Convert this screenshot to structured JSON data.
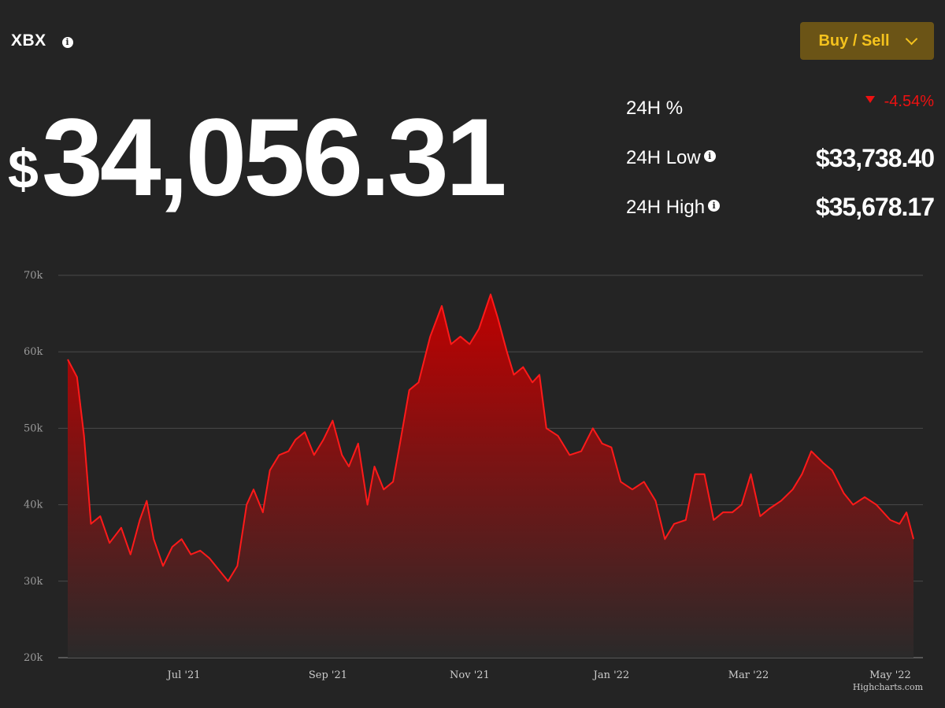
{
  "header": {
    "ticker": "XBX",
    "buy_sell_label": "Buy / Sell"
  },
  "price": {
    "currency": "$",
    "value": "34,056.31"
  },
  "stats": {
    "change_label": "24H %",
    "change_value": "-4.54%",
    "low_label": "24H Low",
    "low_value": "$33,738.40",
    "high_label": "24H High",
    "high_value": "$35,678.17"
  },
  "colors": {
    "background": "#242424",
    "line": "#ff1a1a",
    "accent": "#f4c21d",
    "button_bg": "#6b5416",
    "negative": "#ee1111"
  },
  "chart_data": {
    "type": "area",
    "title": "",
    "xlabel": "",
    "ylabel": "",
    "ylim": [
      20000,
      70000
    ],
    "yticks": [
      20000,
      30000,
      40000,
      50000,
      60000,
      70000
    ],
    "ytick_labels": [
      "20k",
      "30k",
      "40k",
      "50k",
      "60k",
      "70k"
    ],
    "xticks": [
      "2021-07-01",
      "2021-09-01",
      "2021-11-01",
      "2022-01-01",
      "2022-03-01",
      "2022-05-01"
    ],
    "xtick_labels": [
      "Jul '21",
      "Sep '21",
      "Nov '21",
      "Jan '22",
      "Mar '22",
      "May '22"
    ],
    "xlim": [
      "2021-05-12",
      "2022-05-11"
    ],
    "grid": true,
    "series": [
      {
        "x": [
          "2021-05-12",
          "2021-05-16",
          "2021-05-19",
          "2021-05-22",
          "2021-05-26",
          "2021-05-30",
          "2021-06-04",
          "2021-06-08",
          "2021-06-12",
          "2021-06-15",
          "2021-06-18",
          "2021-06-22",
          "2021-06-26",
          "2021-06-30",
          "2021-07-04",
          "2021-07-08",
          "2021-07-12",
          "2021-07-16",
          "2021-07-20",
          "2021-07-24",
          "2021-07-28",
          "2021-07-31",
          "2021-08-04",
          "2021-08-07",
          "2021-08-11",
          "2021-08-15",
          "2021-08-18",
          "2021-08-22",
          "2021-08-26",
          "2021-08-30",
          "2021-09-03",
          "2021-09-07",
          "2021-09-10",
          "2021-09-14",
          "2021-09-18",
          "2021-09-21",
          "2021-09-25",
          "2021-09-29",
          "2021-10-02",
          "2021-10-06",
          "2021-10-10",
          "2021-10-15",
          "2021-10-20",
          "2021-10-24",
          "2021-10-28",
          "2021-11-01",
          "2021-11-05",
          "2021-11-10",
          "2021-11-13",
          "2021-11-17",
          "2021-11-20",
          "2021-11-24",
          "2021-11-28",
          "2021-12-01",
          "2021-12-04",
          "2021-12-09",
          "2021-12-14",
          "2021-12-19",
          "2021-12-24",
          "2021-12-28",
          "2022-01-01",
          "2022-01-05",
          "2022-01-10",
          "2022-01-15",
          "2022-01-20",
          "2022-01-24",
          "2022-01-28",
          "2022-02-02",
          "2022-02-06",
          "2022-02-10",
          "2022-02-14",
          "2022-02-18",
          "2022-02-22",
          "2022-02-26",
          "2022-03-02",
          "2022-03-06",
          "2022-03-10",
          "2022-03-15",
          "2022-03-20",
          "2022-03-24",
          "2022-03-28",
          "2022-04-02",
          "2022-04-06",
          "2022-04-11",
          "2022-04-15",
          "2022-04-20",
          "2022-04-25",
          "2022-05-01",
          "2022-05-05",
          "2022-05-08",
          "2022-05-11"
        ],
        "values": [
          59000,
          56700,
          49000,
          37500,
          38500,
          35000,
          37000,
          33500,
          38000,
          40500,
          35500,
          32000,
          34500,
          35500,
          33500,
          34000,
          33000,
          31500,
          30000,
          32000,
          40000,
          42000,
          39000,
          44500,
          46500,
          47000,
          48500,
          49500,
          46500,
          48500,
          51000,
          46500,
          45000,
          48000,
          40000,
          45000,
          42000,
          43000,
          48000,
          55000,
          56000,
          62000,
          66000,
          61000,
          62000,
          61000,
          63000,
          67500,
          64500,
          60000,
          57000,
          58000,
          56000,
          57000,
          50000,
          49000,
          46500,
          47000,
          50000,
          48000,
          47500,
          43000,
          42000,
          43000,
          40500,
          35500,
          37500,
          38000,
          44000,
          44000,
          38000,
          39000,
          39000,
          40000,
          44000,
          38500,
          39500,
          40500,
          42000,
          44000,
          47000,
          45500,
          44500,
          41500,
          40000,
          41000,
          40000,
          38000,
          37500,
          39000,
          35500
        ]
      }
    ]
  }
}
